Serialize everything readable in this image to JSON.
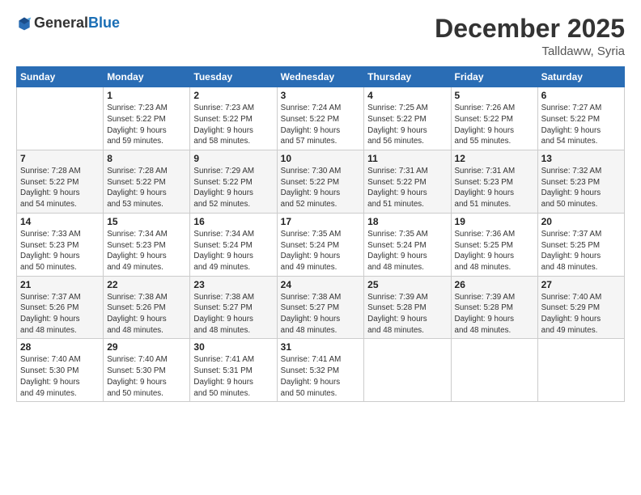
{
  "header": {
    "logo_general": "General",
    "logo_blue": "Blue",
    "month_title": "December 2025",
    "location": "Talldaww, Syria"
  },
  "days_of_week": [
    "Sunday",
    "Monday",
    "Tuesday",
    "Wednesday",
    "Thursday",
    "Friday",
    "Saturday"
  ],
  "weeks": [
    [
      {
        "day": "",
        "info": ""
      },
      {
        "day": "1",
        "info": "Sunrise: 7:23 AM\nSunset: 5:22 PM\nDaylight: 9 hours\nand 59 minutes."
      },
      {
        "day": "2",
        "info": "Sunrise: 7:23 AM\nSunset: 5:22 PM\nDaylight: 9 hours\nand 58 minutes."
      },
      {
        "day": "3",
        "info": "Sunrise: 7:24 AM\nSunset: 5:22 PM\nDaylight: 9 hours\nand 57 minutes."
      },
      {
        "day": "4",
        "info": "Sunrise: 7:25 AM\nSunset: 5:22 PM\nDaylight: 9 hours\nand 56 minutes."
      },
      {
        "day": "5",
        "info": "Sunrise: 7:26 AM\nSunset: 5:22 PM\nDaylight: 9 hours\nand 55 minutes."
      },
      {
        "day": "6",
        "info": "Sunrise: 7:27 AM\nSunset: 5:22 PM\nDaylight: 9 hours\nand 54 minutes."
      }
    ],
    [
      {
        "day": "7",
        "info": "Sunrise: 7:28 AM\nSunset: 5:22 PM\nDaylight: 9 hours\nand 54 minutes."
      },
      {
        "day": "8",
        "info": "Sunrise: 7:28 AM\nSunset: 5:22 PM\nDaylight: 9 hours\nand 53 minutes."
      },
      {
        "day": "9",
        "info": "Sunrise: 7:29 AM\nSunset: 5:22 PM\nDaylight: 9 hours\nand 52 minutes."
      },
      {
        "day": "10",
        "info": "Sunrise: 7:30 AM\nSunset: 5:22 PM\nDaylight: 9 hours\nand 52 minutes."
      },
      {
        "day": "11",
        "info": "Sunrise: 7:31 AM\nSunset: 5:22 PM\nDaylight: 9 hours\nand 51 minutes."
      },
      {
        "day": "12",
        "info": "Sunrise: 7:31 AM\nSunset: 5:23 PM\nDaylight: 9 hours\nand 51 minutes."
      },
      {
        "day": "13",
        "info": "Sunrise: 7:32 AM\nSunset: 5:23 PM\nDaylight: 9 hours\nand 50 minutes."
      }
    ],
    [
      {
        "day": "14",
        "info": "Sunrise: 7:33 AM\nSunset: 5:23 PM\nDaylight: 9 hours\nand 50 minutes."
      },
      {
        "day": "15",
        "info": "Sunrise: 7:34 AM\nSunset: 5:23 PM\nDaylight: 9 hours\nand 49 minutes."
      },
      {
        "day": "16",
        "info": "Sunrise: 7:34 AM\nSunset: 5:24 PM\nDaylight: 9 hours\nand 49 minutes."
      },
      {
        "day": "17",
        "info": "Sunrise: 7:35 AM\nSunset: 5:24 PM\nDaylight: 9 hours\nand 49 minutes."
      },
      {
        "day": "18",
        "info": "Sunrise: 7:35 AM\nSunset: 5:24 PM\nDaylight: 9 hours\nand 48 minutes."
      },
      {
        "day": "19",
        "info": "Sunrise: 7:36 AM\nSunset: 5:25 PM\nDaylight: 9 hours\nand 48 minutes."
      },
      {
        "day": "20",
        "info": "Sunrise: 7:37 AM\nSunset: 5:25 PM\nDaylight: 9 hours\nand 48 minutes."
      }
    ],
    [
      {
        "day": "21",
        "info": "Sunrise: 7:37 AM\nSunset: 5:26 PM\nDaylight: 9 hours\nand 48 minutes."
      },
      {
        "day": "22",
        "info": "Sunrise: 7:38 AM\nSunset: 5:26 PM\nDaylight: 9 hours\nand 48 minutes."
      },
      {
        "day": "23",
        "info": "Sunrise: 7:38 AM\nSunset: 5:27 PM\nDaylight: 9 hours\nand 48 minutes."
      },
      {
        "day": "24",
        "info": "Sunrise: 7:38 AM\nSunset: 5:27 PM\nDaylight: 9 hours\nand 48 minutes."
      },
      {
        "day": "25",
        "info": "Sunrise: 7:39 AM\nSunset: 5:28 PM\nDaylight: 9 hours\nand 48 minutes."
      },
      {
        "day": "26",
        "info": "Sunrise: 7:39 AM\nSunset: 5:28 PM\nDaylight: 9 hours\nand 48 minutes."
      },
      {
        "day": "27",
        "info": "Sunrise: 7:40 AM\nSunset: 5:29 PM\nDaylight: 9 hours\nand 49 minutes."
      }
    ],
    [
      {
        "day": "28",
        "info": "Sunrise: 7:40 AM\nSunset: 5:30 PM\nDaylight: 9 hours\nand 49 minutes."
      },
      {
        "day": "29",
        "info": "Sunrise: 7:40 AM\nSunset: 5:30 PM\nDaylight: 9 hours\nand 50 minutes."
      },
      {
        "day": "30",
        "info": "Sunrise: 7:41 AM\nSunset: 5:31 PM\nDaylight: 9 hours\nand 50 minutes."
      },
      {
        "day": "31",
        "info": "Sunrise: 7:41 AM\nSunset: 5:32 PM\nDaylight: 9 hours\nand 50 minutes."
      },
      {
        "day": "",
        "info": ""
      },
      {
        "day": "",
        "info": ""
      },
      {
        "day": "",
        "info": ""
      }
    ]
  ]
}
